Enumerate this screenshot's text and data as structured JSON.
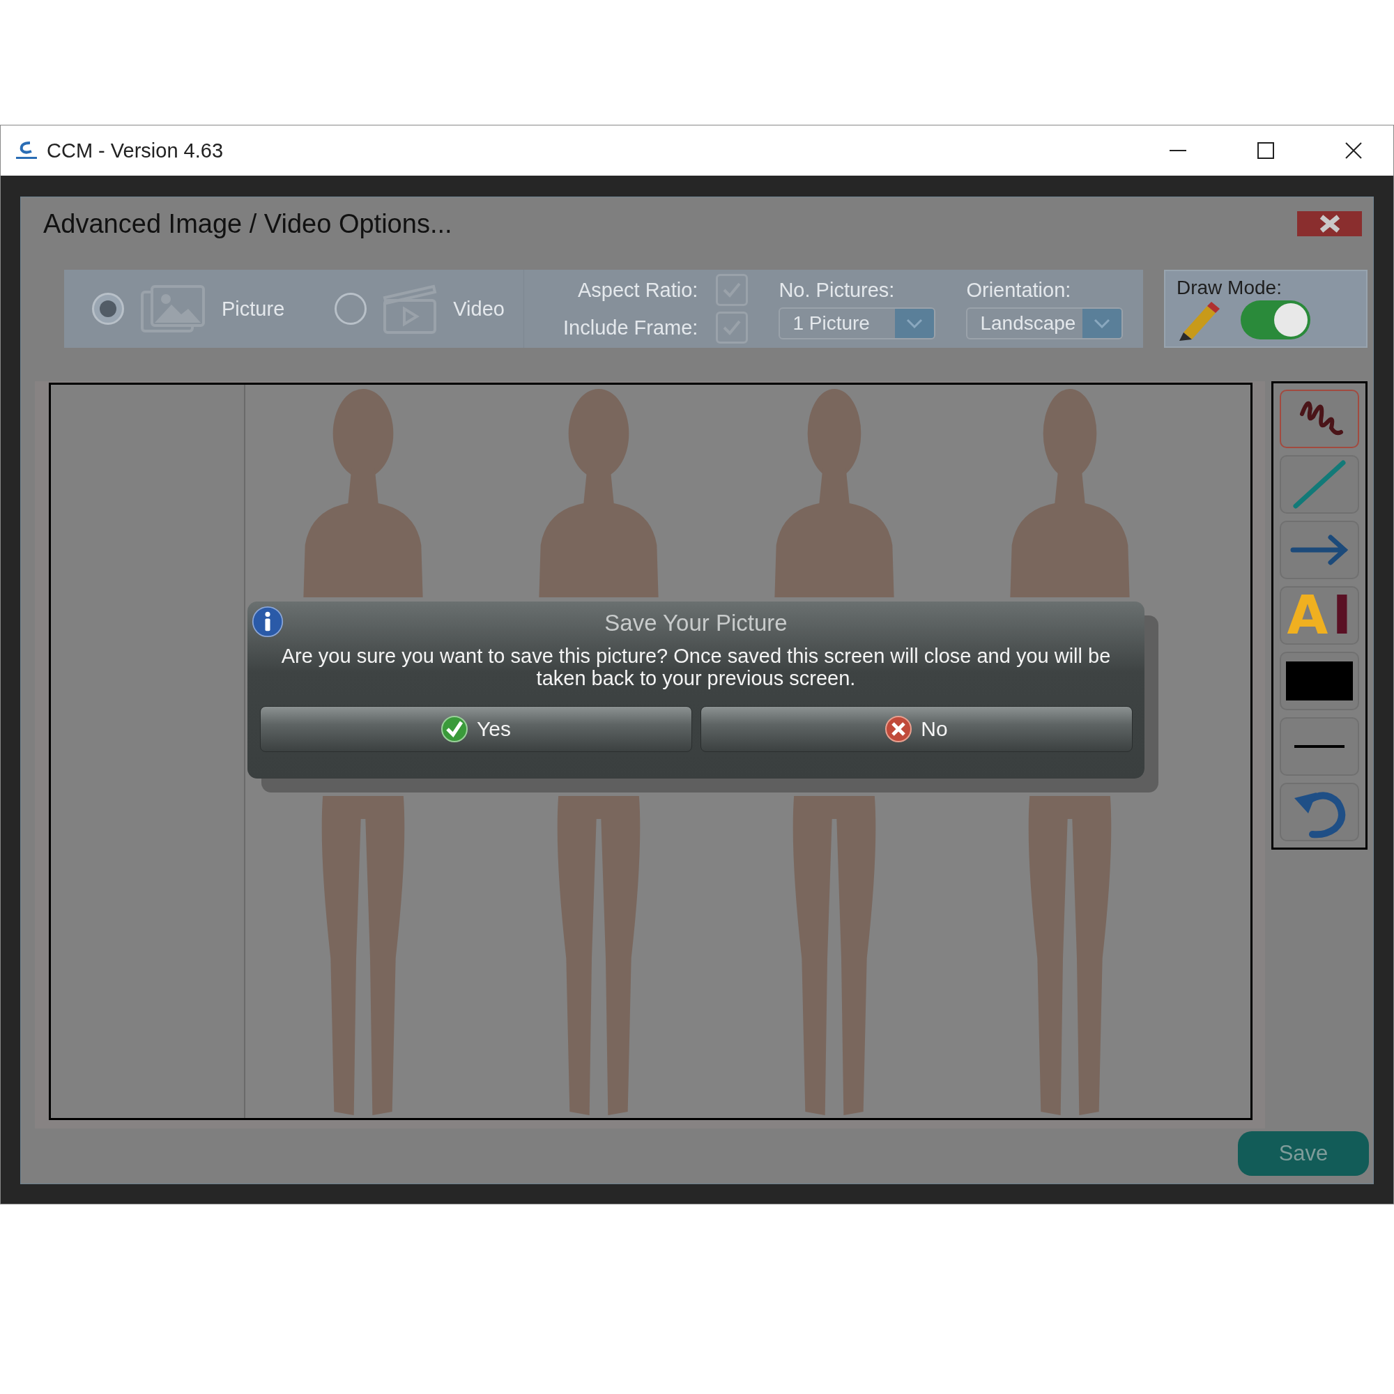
{
  "window": {
    "title": "CCM - Version 4.63"
  },
  "panel": {
    "title": "Advanced Image / Video Options..."
  },
  "media_types": [
    {
      "kind": "picture",
      "label": "Picture",
      "selected": true
    },
    {
      "kind": "video",
      "label": "Video",
      "selected": false
    }
  ],
  "options": {
    "aspect_ratio": {
      "label": "Aspect Ratio:",
      "checked": true
    },
    "include_frame": {
      "label": "Include Frame:",
      "checked": true
    },
    "pictures": {
      "label": "No. Pictures:",
      "value": "1 Picture"
    },
    "orientation": {
      "label": "Orientation:",
      "value": "Landscape"
    }
  },
  "draw_mode": {
    "label": "Draw Mode:",
    "on": true
  },
  "tools": [
    {
      "kind": "freehand",
      "selected": true
    },
    {
      "kind": "line",
      "selected": false
    },
    {
      "kind": "arrow",
      "selected": false
    },
    {
      "kind": "text",
      "selected": false,
      "letters": [
        "A",
        "I"
      ]
    },
    {
      "kind": "color",
      "selected": false,
      "color": "#000000"
    },
    {
      "kind": "thickness",
      "selected": false
    },
    {
      "kind": "undo",
      "selected": false
    }
  ],
  "dialog": {
    "title": "Save Your Picture",
    "message": "Are you sure you want to save this picture?  Once saved this screen will close and you will be taken back to your previous screen.",
    "buttons": [
      {
        "kind": "yes",
        "label": "Yes"
      },
      {
        "kind": "no",
        "label": "No"
      }
    ]
  },
  "save_button": {
    "label": "Save"
  }
}
